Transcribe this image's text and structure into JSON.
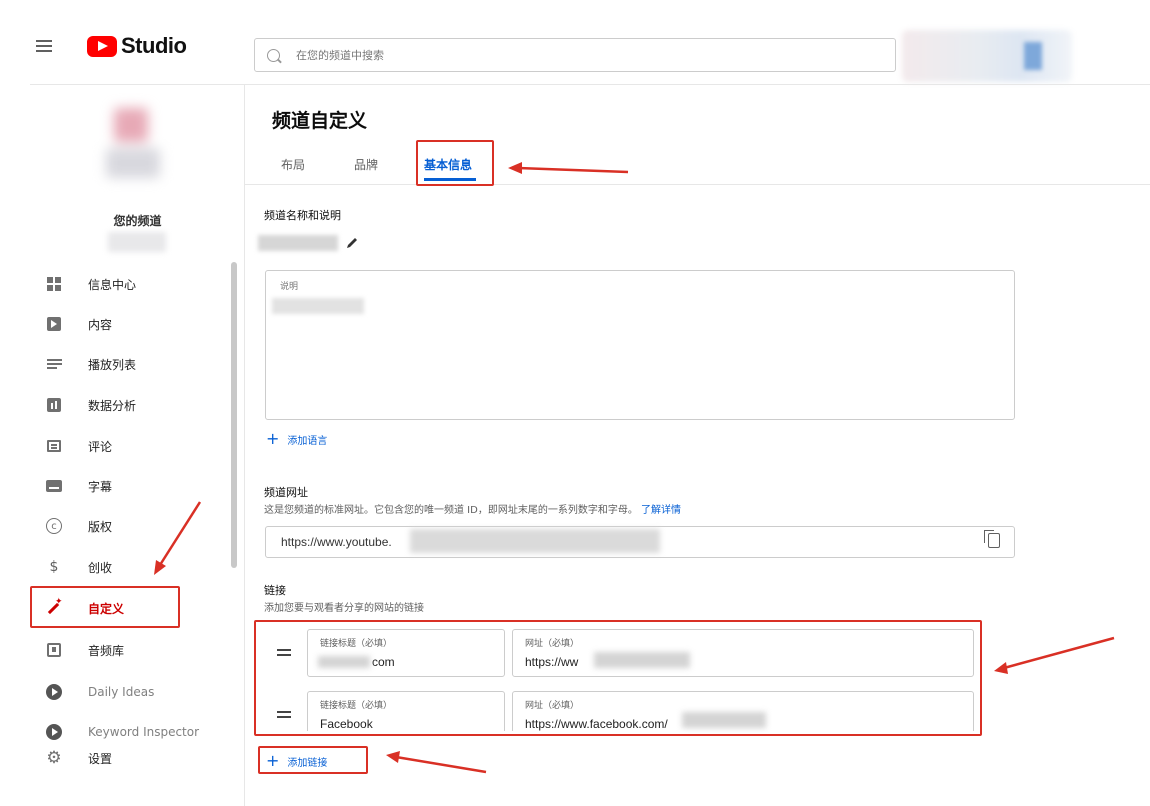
{
  "header": {
    "logo_text": "Studio",
    "search_placeholder": "在您的频道中搜索"
  },
  "sidebar": {
    "channel_label": "您的频道",
    "items": [
      {
        "label": "信息中心",
        "icon": "dashboard-icon"
      },
      {
        "label": "内容",
        "icon": "content-icon"
      },
      {
        "label": "播放列表",
        "icon": "playlist-icon"
      },
      {
        "label": "数据分析",
        "icon": "analytics-icon"
      },
      {
        "label": "评论",
        "icon": "comments-icon"
      },
      {
        "label": "字幕",
        "icon": "subtitles-icon"
      },
      {
        "label": "版权",
        "icon": "copyright-icon"
      },
      {
        "label": "创收",
        "icon": "monetization-icon"
      },
      {
        "label": "自定义",
        "icon": "customize-wand-icon",
        "active": true
      },
      {
        "label": "音频库",
        "icon": "audio-library-icon"
      },
      {
        "label": "Daily Ideas",
        "icon": "extension-icon"
      },
      {
        "label": "Keyword Inspector",
        "icon": "extension-icon"
      },
      {
        "label": "设置",
        "icon": "gear-icon"
      }
    ]
  },
  "main": {
    "title": "频道自定义",
    "tabs": [
      {
        "label": "布局"
      },
      {
        "label": "品牌"
      },
      {
        "label": "基本信息",
        "active": true
      }
    ],
    "name_section": {
      "title": "频道名称和说明",
      "description_label": "说明"
    },
    "add_language": "添加语言",
    "url_section": {
      "title": "频道网址",
      "desc": "这是您频道的标准网址。它包含您的唯一频道 ID，即网址末尾的一系列数字和字母。",
      "learn_more": "了解详情",
      "url_value": "https://www.youtube."
    },
    "links_section": {
      "title": "链接",
      "desc": "添加您要与观看者分享的网站的链接",
      "links": [
        {
          "title_label": "链接标题（必填）",
          "title_value": "com",
          "url_label": "网址（必填）",
          "url_value": "https://ww"
        },
        {
          "title_label": "链接标题（必填）",
          "title_value": "Facebook",
          "url_label": "网址（必填）",
          "url_value": "https://www.facebook.com/"
        }
      ],
      "add_link": "添加链接"
    }
  },
  "colors": {
    "accent_blue": "#065fd4",
    "brand_red": "#ff0000",
    "annotation_red": "#d93025"
  }
}
